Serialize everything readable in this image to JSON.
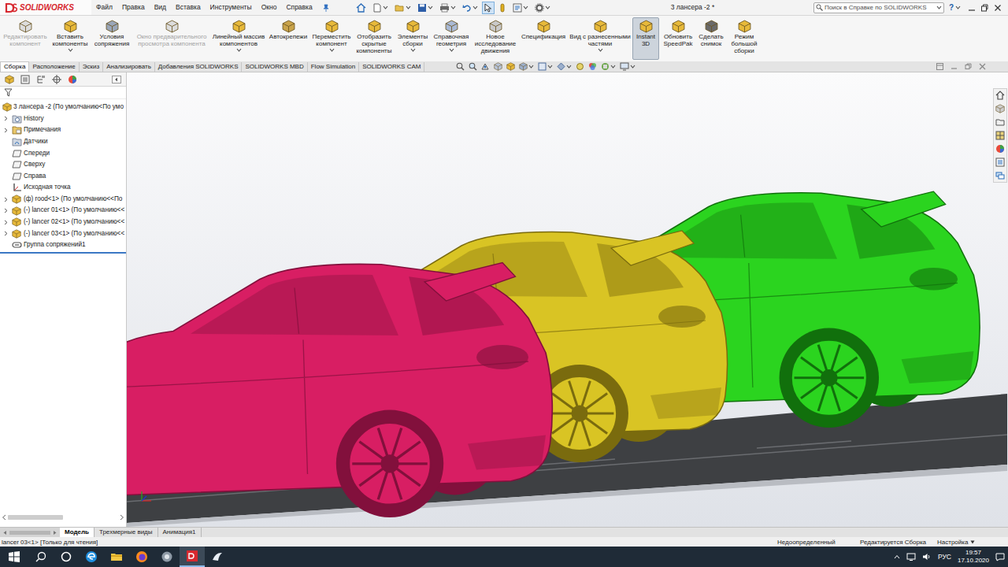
{
  "app": {
    "logo": "SOLIDWORKS"
  },
  "menu": [
    "Файл",
    "Правка",
    "Вид",
    "Вставка",
    "Инструменты",
    "Окно",
    "Справка"
  ],
  "quick_access": [
    {
      "kind": "home",
      "selected": false
    },
    {
      "kind": "new",
      "selected": false
    },
    {
      "kind": "open",
      "selected": false
    },
    {
      "kind": "save",
      "selected": false
    },
    {
      "kind": "print",
      "selected": false
    },
    {
      "kind": "undo",
      "selected": false
    },
    {
      "kind": "select",
      "selected": true
    },
    {
      "kind": "rebuild",
      "selected": false
    },
    {
      "kind": "properties",
      "selected": false
    },
    {
      "kind": "options",
      "selected": false
    }
  ],
  "window": {
    "title": "3 лансера -2 *"
  },
  "search": {
    "placeholder": "Поиск в Справке по SOLIDWORKS"
  },
  "help": {
    "label": "?"
  },
  "commands": [
    {
      "label": "Редактировать компонент",
      "disabled": true,
      "selected": false,
      "dropdown": false
    },
    {
      "label": "Вставить компоненты",
      "disabled": false,
      "selected": false,
      "dropdown": true
    },
    {
      "label": "Условия сопряжения",
      "disabled": false,
      "selected": false,
      "dropdown": false
    },
    {
      "label": "Окно предварительного просмотра компонента",
      "disabled": true,
      "selected": false,
      "dropdown": false
    },
    {
      "label": "Линейный массив компонентов",
      "disabled": false,
      "selected": false,
      "dropdown": true
    },
    {
      "label": "Автокрепежи",
      "disabled": false,
      "selected": false,
      "dropdown": false
    },
    {
      "label": "Переместить компонент",
      "disabled": false,
      "selected": false,
      "dropdown": true
    },
    {
      "label": "Отобразить скрытые компоненты",
      "disabled": false,
      "selected": false,
      "dropdown": false
    },
    {
      "label": "Элементы сборки",
      "disabled": false,
      "selected": false,
      "dropdown": true
    },
    {
      "label": "Справочная геометрия",
      "disabled": false,
      "selected": false,
      "dropdown": true
    },
    {
      "label": "Новое исследование движения",
      "disabled": false,
      "selected": false,
      "dropdown": false
    },
    {
      "label": "Спецификация",
      "disabled": false,
      "selected": false,
      "dropdown": false
    },
    {
      "label": "Вид с разнесенными частями",
      "disabled": false,
      "selected": false,
      "dropdown": true
    },
    {
      "label": "Instant 3D",
      "disabled": false,
      "selected": true,
      "dropdown": false
    },
    {
      "label": "Обновить SpeedPak",
      "disabled": false,
      "selected": false,
      "dropdown": false
    },
    {
      "label": "Сделать снимок",
      "disabled": false,
      "selected": false,
      "dropdown": false
    },
    {
      "label": "Режим большой сборки",
      "disabled": false,
      "selected": false,
      "dropdown": false
    }
  ],
  "tabs": [
    {
      "label": "Сборка",
      "selected": true
    },
    {
      "label": "Расположение",
      "selected": false
    },
    {
      "label": "Эскиз",
      "selected": false
    },
    {
      "label": "Анализировать",
      "selected": false
    },
    {
      "label": "Добавления SOLIDWORKS",
      "selected": false
    },
    {
      "label": "SOLIDWORKS MBD",
      "selected": false
    },
    {
      "label": "Flow Simulation",
      "selected": false
    },
    {
      "label": "SOLIDWORKS CAM",
      "selected": false
    }
  ],
  "tree": {
    "root": "3 лансера -2 (По умолчанию<По умо",
    "items": [
      {
        "label": "History",
        "kind": "history",
        "expandable": true
      },
      {
        "label": "Примечания",
        "kind": "folder",
        "expandable": true
      },
      {
        "label": "Датчики",
        "kind": "sensor",
        "expandable": false
      },
      {
        "label": "Спереди",
        "kind": "plane",
        "expandable": false
      },
      {
        "label": "Сверху",
        "kind": "plane",
        "expandable": false
      },
      {
        "label": "Справа",
        "kind": "plane",
        "expandable": false
      },
      {
        "label": "Исходная точка",
        "kind": "origin",
        "expandable": false
      },
      {
        "label": "(ф) rood<1> (По умолчанию<<По",
        "kind": "part",
        "expandable": true
      },
      {
        "label": "(-) lancer 01<1> (По умолчанию<<",
        "kind": "part",
        "expandable": true
      },
      {
        "label": "(-) lancer 02<1> (По умолчанию<<",
        "kind": "part",
        "expandable": true
      },
      {
        "label": "(-) lancer 03<1> (По умолчанию<<",
        "kind": "part",
        "expandable": true
      },
      {
        "label": "Группа сопряжений1",
        "kind": "mates",
        "expandable": false
      }
    ]
  },
  "bottom_tabs": [
    {
      "label": "Модель",
      "selected": true
    },
    {
      "label": "Трехмерные виды",
      "selected": false
    },
    {
      "label": "Анимация1",
      "selected": false
    }
  ],
  "status_bar": {
    "message": "lancer 03<1> [Только для чтения]",
    "items": [
      "Недоопределенный",
      "Редактируется Сборка",
      "Настройка"
    ]
  },
  "taskbar": {
    "apps": [
      {
        "kind": "edge",
        "active": false
      },
      {
        "kind": "explorer",
        "active": false
      },
      {
        "kind": "firefox",
        "active": false
      },
      {
        "kind": "app",
        "active": false
      },
      {
        "kind": "solidworks",
        "active": true
      },
      {
        "kind": "other",
        "active": false
      }
    ],
    "language": "РУС",
    "time": "19:57",
    "date": "17.10.2020"
  }
}
